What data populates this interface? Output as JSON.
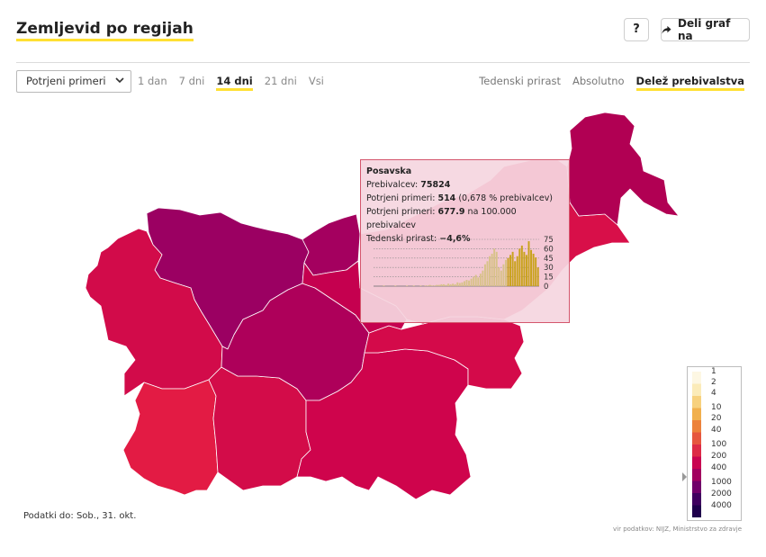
{
  "header": {
    "title": "Zemljevid po regijah",
    "help_label": "?",
    "share_label": "Deli graf na"
  },
  "controls": {
    "select_value": "Potrjeni primeri",
    "periods": [
      "1 dan",
      "7 dni",
      "14 dni",
      "21 dni",
      "Vsi"
    ],
    "active_period": "14 dni",
    "modes": [
      "Tedenski prirast",
      "Absolutno",
      "Delež prebivalstva"
    ],
    "active_mode": "Delež prebivalstva"
  },
  "map": {
    "regions": [
      {
        "id": "pomurska",
        "color": "#b10053"
      },
      {
        "id": "podravska",
        "color": "#d80f49"
      },
      {
        "id": "koroska",
        "color": "#a4005f"
      },
      {
        "id": "savinjska",
        "color": "#c5004f"
      },
      {
        "id": "zasavska",
        "color": "#b40057"
      },
      {
        "id": "posavska",
        "color": "#d40a4a"
      },
      {
        "id": "jugovzhodna-slovenija",
        "color": "#cf044c"
      },
      {
        "id": "osrednjeslovenska",
        "color": "#ae005a"
      },
      {
        "id": "gorenjska",
        "color": "#9b0062"
      },
      {
        "id": "primorsko-notranjska",
        "color": "#d30c49"
      },
      {
        "id": "goriska",
        "color": "#d20b4a"
      },
      {
        "id": "obalno-kraska",
        "color": "#e31b44"
      }
    ]
  },
  "tooltip": {
    "region": "Posavska",
    "population_label": "Prebivalcev:",
    "population_value": "75824",
    "confirmed_label": "Potrjeni primeri:",
    "confirmed_value": "514",
    "confirmed_pct": "(0,678 % prebivalcev)",
    "per100k_label": "Potrjeni primeri:",
    "per100k_value": "677.9",
    "per100k_suffix": "na 100.000 prebivalcev",
    "weekly_label": "Tedenski prirast:",
    "weekly_value": "−4,6%",
    "chart_data": {
      "type": "bar",
      "ylim": [
        0,
        75
      ],
      "ticks": [
        "75",
        "60",
        "45",
        "30",
        "15",
        "0"
      ],
      "values": [
        0,
        0,
        0,
        0,
        1,
        0,
        0,
        0,
        0,
        1,
        0,
        0,
        0,
        0,
        1,
        0,
        0,
        1,
        0,
        0,
        1,
        0,
        1,
        1,
        2,
        1,
        1,
        2,
        2,
        3,
        3,
        2,
        4,
        3,
        4,
        3,
        6,
        5,
        6,
        8,
        10,
        9,
        12,
        15,
        18,
        14,
        20,
        25,
        35,
        40,
        48,
        52,
        60,
        55,
        30,
        25,
        35,
        42,
        45,
        50,
        55,
        40,
        48,
        60,
        65,
        55,
        50,
        72,
        58,
        52,
        46,
        30
      ],
      "highlight_from": 58
    }
  },
  "legend": {
    "labels": [
      "1",
      "2",
      "4",
      "10",
      "20",
      "40",
      "100",
      "200",
      "400",
      "1000",
      "2000",
      "4000"
    ],
    "colors": [
      "#fdf7e3",
      "#fbebb9",
      "#f7d17e",
      "#f1b04d",
      "#ec823c",
      "#e6573f",
      "#dd2b47",
      "#c90451",
      "#a2005f",
      "#70006a",
      "#3f005f",
      "#1f004c"
    ]
  },
  "footer": {
    "data_date": "Podatki do: Sob., 31. okt.",
    "source": "vir podatkov: NIJZ, Ministrstvo za zdravje"
  }
}
